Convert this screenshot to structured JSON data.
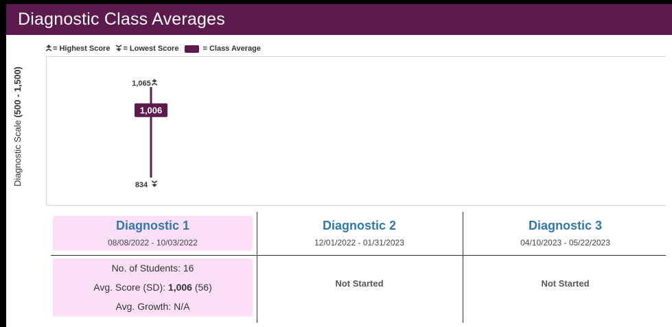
{
  "header": {
    "title": "Diagnostic Class Averages"
  },
  "legend": {
    "highest": {
      "icon": "highest-score-icon",
      "label": "= Highest Score"
    },
    "lowest": {
      "icon": "lowest-score-icon",
      "label": "= Lowest Score"
    },
    "average": {
      "label": "= Class Average",
      "color": "#5c1a4e"
    }
  },
  "chart_data": {
    "type": "range",
    "ylabel": "Diagnostic Scale",
    "ylabel_range": "(500 - 1,500)",
    "ylim": [
      500,
      1500
    ],
    "grid": false,
    "series": [
      {
        "category": "Diagnostic 1",
        "high": 1065,
        "high_label": "1,065",
        "low": 834,
        "low_label": "834",
        "average": 1006,
        "average_label": "1,006",
        "color": "#5c1a4e"
      }
    ]
  },
  "sessions": [
    {
      "title": "Diagnostic 1",
      "dates": "08/08/2022 - 10/03/2022",
      "active": true,
      "students_label": "No. of Students: 16",
      "avg_label": "Avg. Score (SD): ",
      "avg_value": "1,006",
      "avg_sd": " (56)",
      "growth_label": "Avg. Growth: N/A"
    },
    {
      "title": "Diagnostic 2",
      "dates": "12/01/2022 - 01/31/2023",
      "active": false,
      "status": "Not Started"
    },
    {
      "title": "Diagnostic 3",
      "dates": "04/10/2023 - 05/22/2023",
      "active": false,
      "status": "Not Started"
    }
  ],
  "colors": {
    "brand": "#5c1a4e",
    "link": "#2f78b0",
    "highlight": "#fbdff7"
  }
}
